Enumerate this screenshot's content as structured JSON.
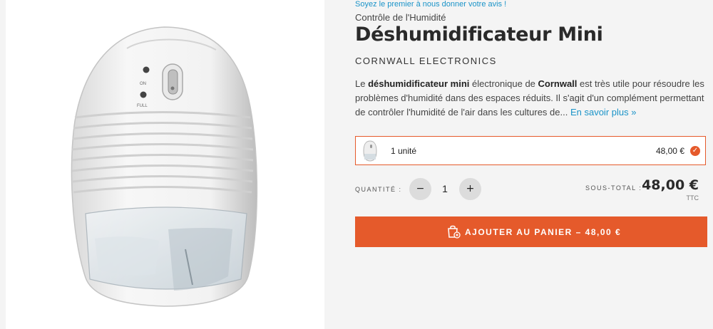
{
  "reviews": {
    "link_text": "Soyez le premier à nous donner votre avis !"
  },
  "product": {
    "category": "Contrôle de l'Humidité",
    "title": "Déshumidificateur Mini",
    "brand": "CORNWALL ELECTRONICS",
    "image_labels": {
      "on": "ON",
      "full": "FULL"
    },
    "description": {
      "p1": "Le ",
      "b1": "déshumidificateur mini",
      "p2": " électronique de ",
      "b2": "Cornwall",
      "p3": " est très utile pour résoudre les problèmes d'humidité dans des espaces réduits. Il s'agit d'un complément permettant de contrôler l'humidité de l'air dans les cultures de... ",
      "more": "En savoir plus »"
    }
  },
  "variant": {
    "label": "1 unité",
    "price": "48,00 €",
    "selected": true,
    "check_icon": "check-icon"
  },
  "quantity": {
    "label": "QUANTITÉ :",
    "minus": "−",
    "plus": "+",
    "value": "1"
  },
  "subtotal": {
    "label": "SOUS-TOTAL :",
    "value": "48,00 €",
    "tax_note": "TTC"
  },
  "cart": {
    "label": "AJOUTER AU PANIER  –  48,00 €",
    "icon": "shopping-bag-icon"
  },
  "colors": {
    "accent": "#e55a2b",
    "link": "#1a93c8",
    "background": "#f4f4f4"
  }
}
